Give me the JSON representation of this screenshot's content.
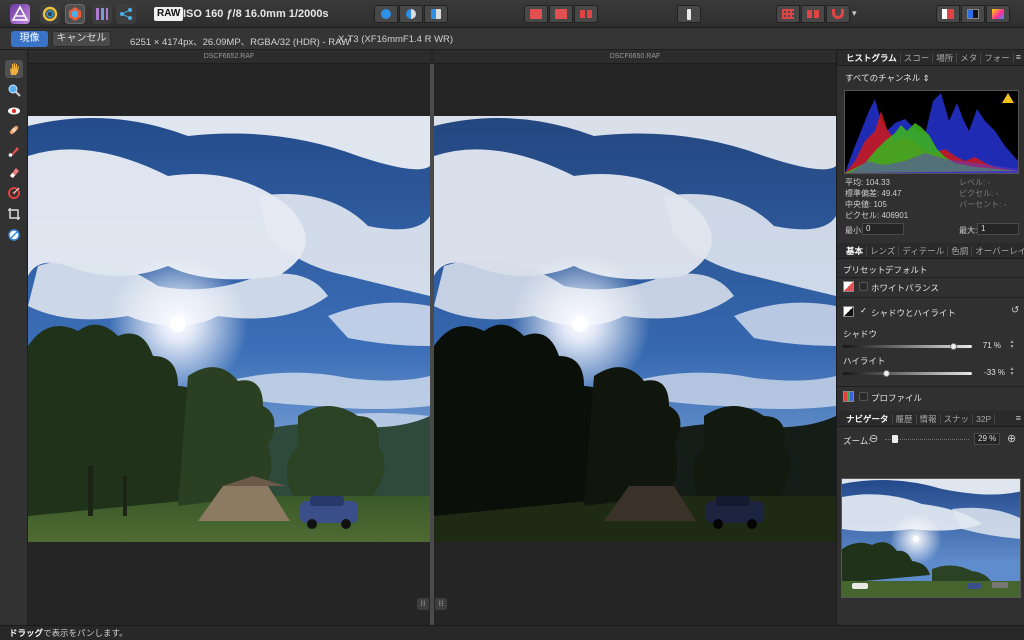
{
  "toolbar": {
    "raw_badge": "RAW",
    "exif_info": "ISO 160 ƒ/8 16.0mm 1/2000s",
    "icons": [
      "affinity-photo-logo",
      "photo-persona-icon",
      "develop-persona-icon",
      "tone-mapping-persona-icon",
      "export-persona-icon"
    ]
  },
  "context_bar": {
    "develop_label": "現像",
    "cancel_label": "キャンセル",
    "image_info": "6251 × 4174px、26.09MP、RGBA/32 (HDR) - RAW",
    "camera_info": "X-T3 (XF16mmF1.4 R WR)"
  },
  "canvas": {
    "left_title": "DSCF6652.RAF",
    "right_title": "DSCF6650.RAF",
    "left_corner_glyph": "⁝⁝",
    "right_corner_glyph": "⁝⁝"
  },
  "histogram_panel": {
    "tabs": [
      "ヒストグラム",
      "スコー",
      "場所",
      "メタ",
      "フォー"
    ],
    "channel": "すべてのチャンネル ⇕",
    "stats_left": [
      "平均: 104.33",
      "標準偏差: 49.47",
      "中央値: 105",
      "ピクセル: 406901"
    ],
    "stats_right": [
      "レベル: -",
      "ピクセル: -",
      "パーセント: -"
    ],
    "min_label": "最小:",
    "min_value": "0",
    "max_label": "最大:",
    "max_value": "1"
  },
  "adjust_panel": {
    "tabs": [
      "基本",
      "レンズ",
      "ディテール",
      "色調",
      "オーバーレイ"
    ],
    "preset_label": "プリセット:",
    "preset_value": "デフォルト",
    "white_balance_label": "ホワイトバランス",
    "shadow_highlight_label": "シャドウとハイライト",
    "shadow_label": "シャドウ",
    "shadow_value": "71 %",
    "shadow_level": 0.855,
    "highlight_label": "ハイライト",
    "highlight_value": "-33 %",
    "highlight_level": 0.335,
    "profile_label": "プロファイル"
  },
  "navigator_panel": {
    "tabs": [
      "ナビゲータ",
      "履歴",
      "情報",
      "スナッ",
      "32P"
    ],
    "zoom_label": "ズーム:",
    "zoom_value": "29 %",
    "zoom_minus": "⊖",
    "zoom_plus": "⊕"
  },
  "statusbar": {
    "bold": "ドラッグ",
    "text": "で表示をパンします。"
  },
  "colors": {
    "accent": "#3a74c8",
    "panel_bg": "#303030",
    "canvas_bg": "#252525"
  }
}
